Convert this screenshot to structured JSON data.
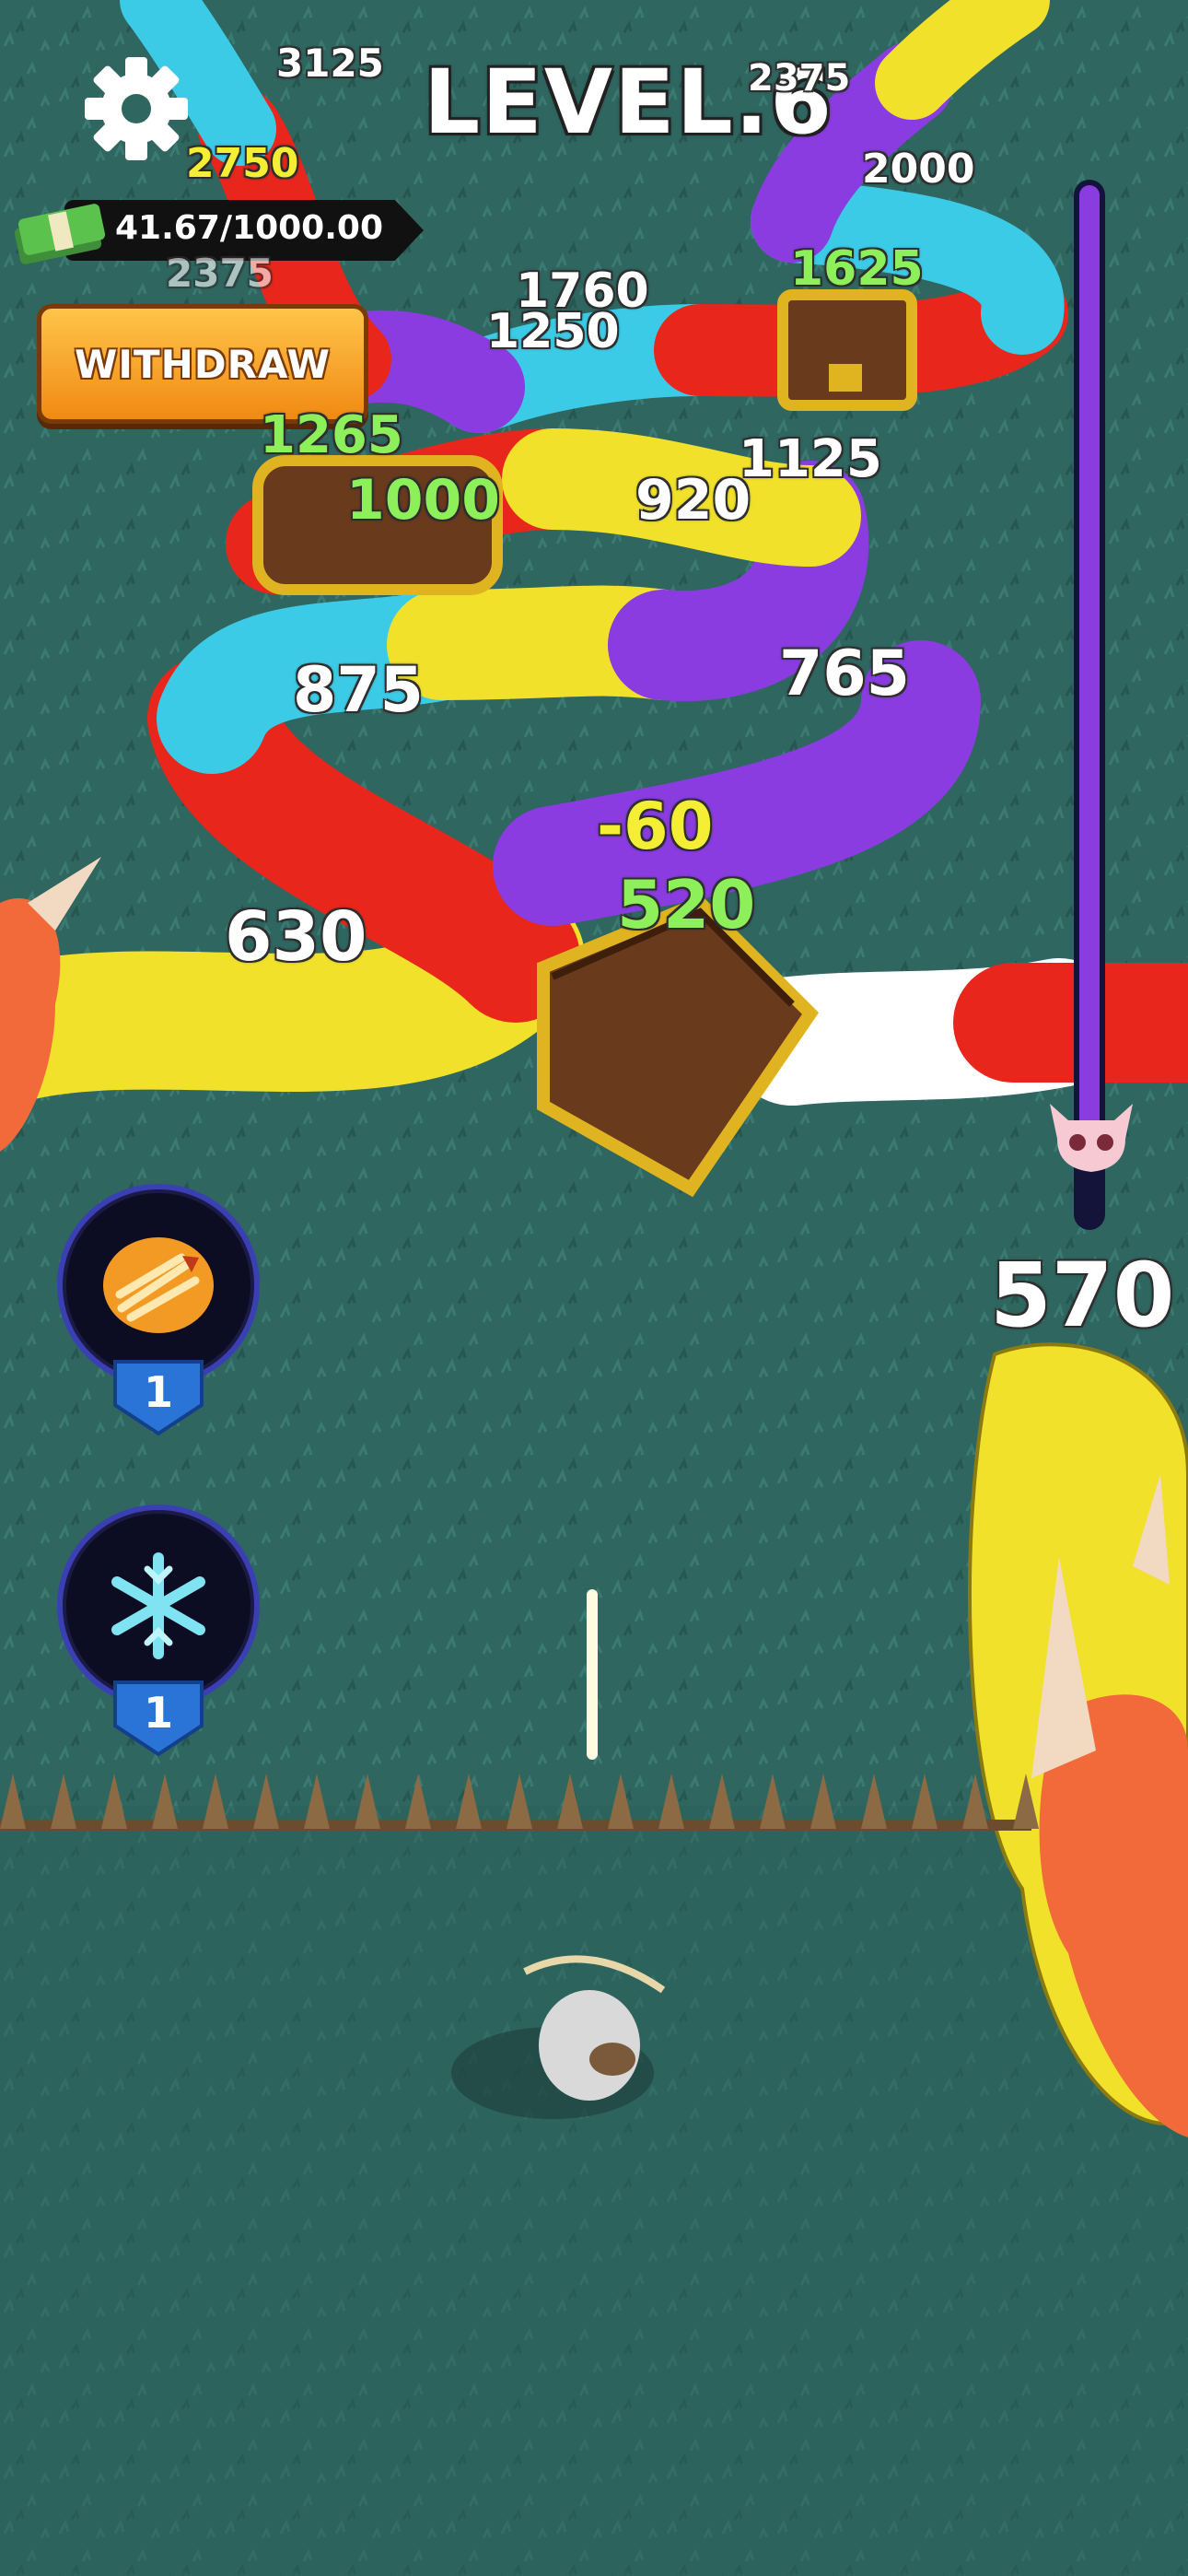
{
  "hud": {
    "level": "LEVEL.6",
    "money": "41.67/1000.00",
    "withdraw_label": "WITHDRAW"
  },
  "skills": [
    {
      "icon": "arrow-burst-icon",
      "count": "1"
    },
    {
      "icon": "snowflake-icon",
      "count": "1"
    }
  ],
  "boss_hp": "570",
  "segment_values": [
    {
      "text": "3125",
      "tone": "white"
    },
    {
      "text": "2375",
      "tone": "white"
    },
    {
      "text": "2750",
      "tone": "yellow"
    },
    {
      "text": "2000",
      "tone": "white"
    },
    {
      "text": "2375",
      "tone": "white"
    },
    {
      "text": "1625",
      "tone": "green"
    },
    {
      "text": "1760",
      "tone": "white"
    },
    {
      "text": "1250",
      "tone": "white"
    },
    {
      "text": "1265",
      "tone": "green"
    },
    {
      "text": "1125",
      "tone": "white"
    },
    {
      "text": "1000",
      "tone": "green"
    },
    {
      "text": "920",
      "tone": "white"
    },
    {
      "text": "875",
      "tone": "white"
    },
    {
      "text": "765",
      "tone": "white"
    },
    {
      "text": "-60",
      "tone": "yellow"
    },
    {
      "text": "520",
      "tone": "green"
    },
    {
      "text": "630",
      "tone": "white"
    }
  ],
  "colors": {
    "ground": "#2f6660",
    "snake_red": "#e8261b",
    "snake_yellow": "#f2e12a",
    "snake_purple": "#8a3ce0",
    "snake_cyan": "#3ccbe6",
    "progress_fill": "#8a3ce0",
    "withdraw_button": "#f5a623"
  },
  "level_progress_fraction": 0.93
}
